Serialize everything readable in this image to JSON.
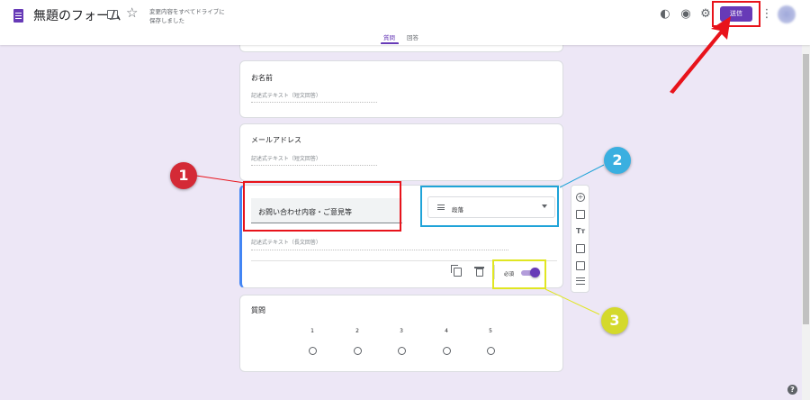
{
  "header": {
    "title": "無題のフォーム",
    "save_status": "変更内容をすべてドライブに保存しました",
    "send_label": "送信",
    "icons": [
      "forms-doc-icon",
      "folder-icon",
      "star-icon",
      "palette-icon",
      "preview-eye-icon",
      "settings-gear-icon",
      "more-vert-icon",
      "avatar"
    ]
  },
  "tabs": [
    {
      "label": "質問",
      "active": true
    },
    {
      "label": "回答",
      "active": false
    }
  ],
  "questions": [
    {
      "title": "お名前",
      "placeholder": "記述式テキスト（短文回答）"
    },
    {
      "title": "メールアドレス",
      "placeholder": "記述式テキスト（短文回答）"
    }
  ],
  "active_question": {
    "title": "お問い合わせ内容・ご意見等",
    "type": "段落",
    "placeholder": "記述式テキスト（長文回答）",
    "required_label": "必須",
    "required": true
  },
  "scale_question": {
    "title": "質問",
    "scale": [
      "1",
      "2",
      "3",
      "4",
      "5"
    ]
  },
  "side_toolbar": [
    "add-question-icon",
    "import-questions-icon",
    "add-title-icon",
    "add-image-icon",
    "add-video-icon",
    "add-section-icon"
  ],
  "annotations": {
    "markers": [
      "1",
      "2",
      "3"
    ],
    "colors": {
      "red": "#e8131b",
      "blue": "#1fa3d8",
      "yellow": "#e0e622"
    }
  },
  "colors": {
    "accent": "#673ab7",
    "background": "#ede7f6",
    "active_border": "#4285f4"
  },
  "help": "?"
}
